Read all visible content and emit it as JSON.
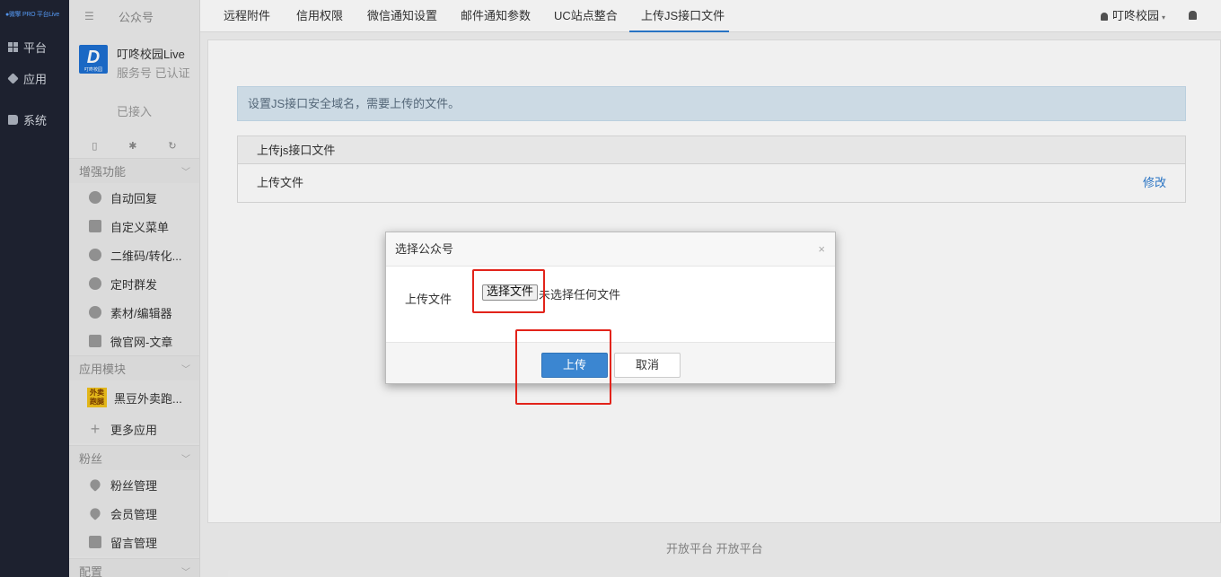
{
  "rail": {
    "logo": "●微擎 PRO 平台Live",
    "items": [
      {
        "label": "平台",
        "icon": "grid-icon"
      },
      {
        "label": "应用",
        "icon": "cube-icon"
      },
      {
        "label": "系统",
        "icon": "book-icon"
      }
    ]
  },
  "sidebar": {
    "header": "公众号",
    "account": {
      "avatar_letter": "D",
      "avatar_caption": "叮咚校园",
      "name": "叮咚校园Live",
      "type": "服务号  已认证",
      "status": "已接入"
    },
    "sections": [
      {
        "title": "增强功能",
        "items": [
          "自动回复",
          "自定义菜单",
          "二维码/转化...",
          "定时群发",
          "素材/编辑器",
          "微官网-文章"
        ]
      },
      {
        "title": "应用模块",
        "items": [
          "黑豆外卖跑...",
          "更多应用"
        ],
        "app_badge": "外卖 跑腿"
      },
      {
        "title": "粉丝",
        "items": [
          "粉丝管理",
          "会员管理",
          "留言管理"
        ]
      },
      {
        "title": "配置",
        "items": []
      }
    ]
  },
  "topbar": {
    "tabs": [
      "远程附件",
      "信用权限",
      "微信通知设置",
      "邮件通知参数",
      "UC站点整合",
      "上传JS接口文件"
    ],
    "active_tab": "上传JS接口文件",
    "user": "叮咚校园",
    "accent": "#2b7bd0"
  },
  "content": {
    "alert": "设置JS接口安全域名，需要上传的文件。",
    "panel_title": "上传js接口文件",
    "row_label": "上传文件",
    "row_action": "修改"
  },
  "footer": "开放平台  开放平台",
  "modal": {
    "title": "选择公众号",
    "close": "×",
    "field_label": "上传文件",
    "file_button": "选择文件",
    "file_status": "未选择任何文件",
    "submit": "上传",
    "cancel": "取消"
  },
  "colors": {
    "highlight": "#e2231a",
    "primary_button": "#3b86d1"
  }
}
